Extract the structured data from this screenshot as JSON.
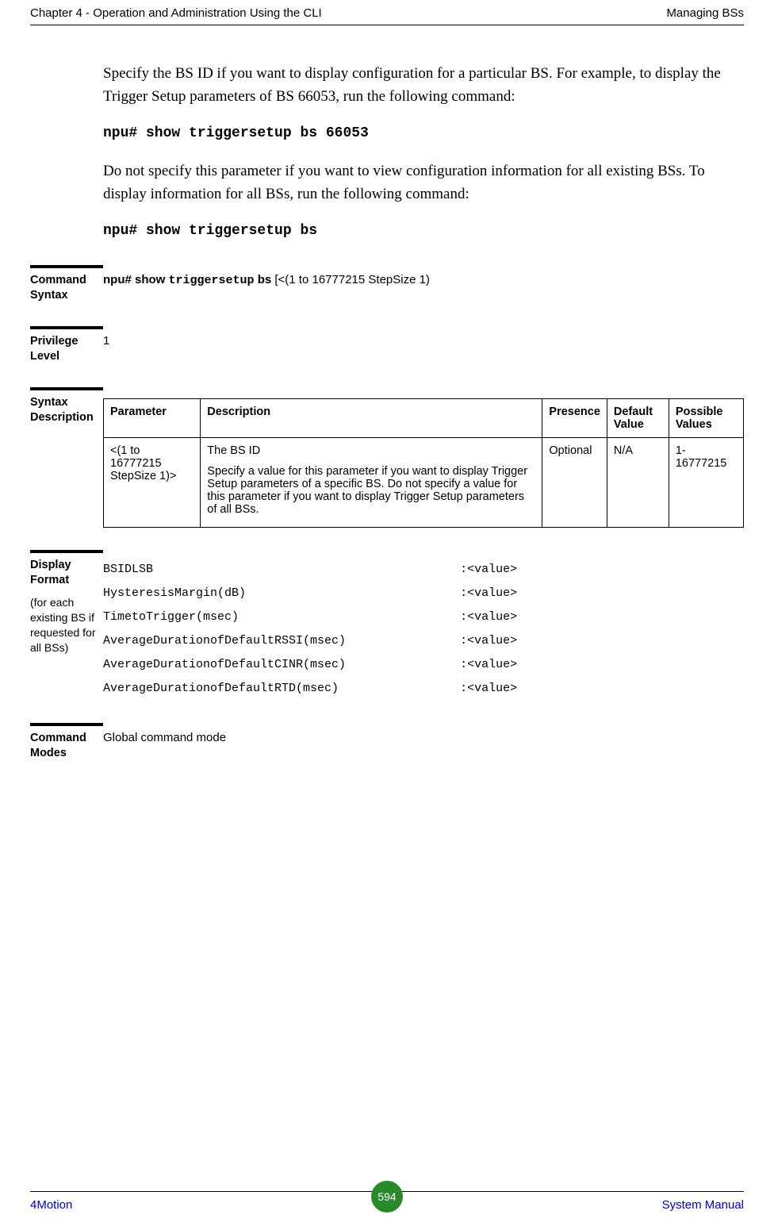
{
  "header": {
    "left": "Chapter 4 - Operation and Administration Using the CLI",
    "right": "Managing BSs"
  },
  "intro": {
    "p1": "Specify the BS ID if you want to display configuration for a particular BS. For example, to display the Trigger Setup parameters of BS 66053, run the following command:",
    "cmd1": "npu# show triggersetup bs 66053",
    "p2": "Do not specify this parameter if you want to view configuration information for all existing BSs. To display information for all BSs, run the following command:",
    "cmd2": "npu# show triggersetup bs"
  },
  "sections": {
    "command_syntax": {
      "label": "Command Syntax",
      "prefix": "npu# show ",
      "bold": "triggersetup",
      "suffix": " bs [<(1 to 16777215 StepSize 1)"
    },
    "privilege_level": {
      "label": "Privilege Level",
      "value": "1"
    },
    "syntax_description": {
      "label": "Syntax Description",
      "headers": {
        "parameter": "Parameter",
        "description": "Description",
        "presence": "Presence",
        "default_value": "Default Value",
        "possible_values": "Possible Values"
      },
      "row": {
        "parameter": "<(1 to 16777215 StepSize 1)>",
        "desc_line1": "The BS ID",
        "desc_line2": "Specify a value for this parameter if you want to display Trigger Setup parameters of a specific BS. Do not specify a value for this parameter if you want to display Trigger Setup parameters of all BSs.",
        "presence": "Optional",
        "default_value": "N/A",
        "possible_values": "1-16777215"
      }
    },
    "display_format": {
      "label": "Display Format",
      "sublabel": "(for each existing BS if requested for all BSs)",
      "lines": [
        "BSIDLSB                                           :<value>",
        "HysteresisMargin(dB)                              :<value>",
        "TimetoTrigger(msec)                               :<value>",
        "AverageDurationofDefaultRSSI(msec)                :<value>",
        "AverageDurationofDefaultCINR(msec)                :<value>",
        "AverageDurationofDefaultRTD(msec)                 :<value>"
      ]
    },
    "command_modes": {
      "label": "Command Modes",
      "value": "Global command mode"
    }
  },
  "footer": {
    "left": "4Motion",
    "page": "594",
    "right": "System Manual"
  }
}
